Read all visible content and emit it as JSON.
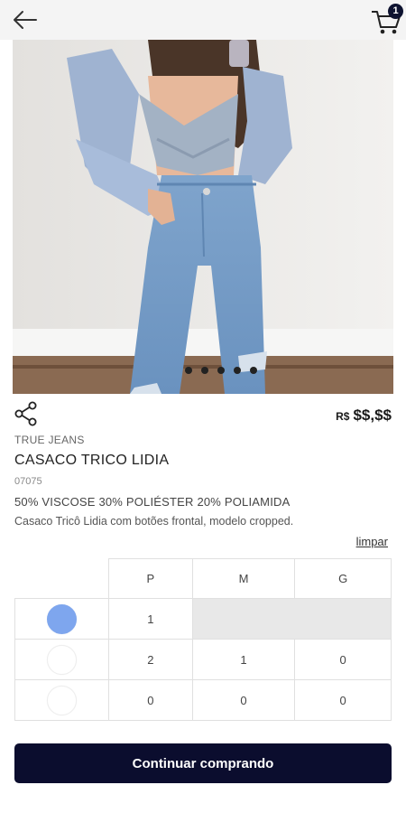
{
  "header": {
    "cart_count": "1"
  },
  "product": {
    "photo_pages": 5,
    "price_currency": "R$",
    "price_value": "$$,$$",
    "brand": "TRUE JEANS",
    "name": "CASACO TRICO LIDIA",
    "sku": "07075",
    "composition": "50% VISCOSE 30% POLIÉSTER 20% POLIAMIDA",
    "description": "Casaco Tricô Lidia com botões frontal, modelo cropped."
  },
  "size_grid": {
    "clear_label": "limpar",
    "sizes": [
      "P",
      "M",
      "G"
    ],
    "rows": [
      {
        "swatch_color": "#7ea6ee",
        "values": [
          "1",
          "",
          ""
        ],
        "disabled": [
          false,
          true,
          true
        ]
      },
      {
        "swatch_color": "#ffffff",
        "values": [
          "2",
          "1",
          "0"
        ],
        "disabled": [
          false,
          false,
          false
        ]
      },
      {
        "swatch_color": "#ffffff",
        "values": [
          "0",
          "0",
          "0"
        ],
        "disabled": [
          false,
          false,
          false
        ]
      }
    ]
  },
  "actions": {
    "continue_label": "Continuar comprando"
  },
  "colors": {
    "primary_button": "#0b0d2e",
    "badge": "#0e1330"
  }
}
